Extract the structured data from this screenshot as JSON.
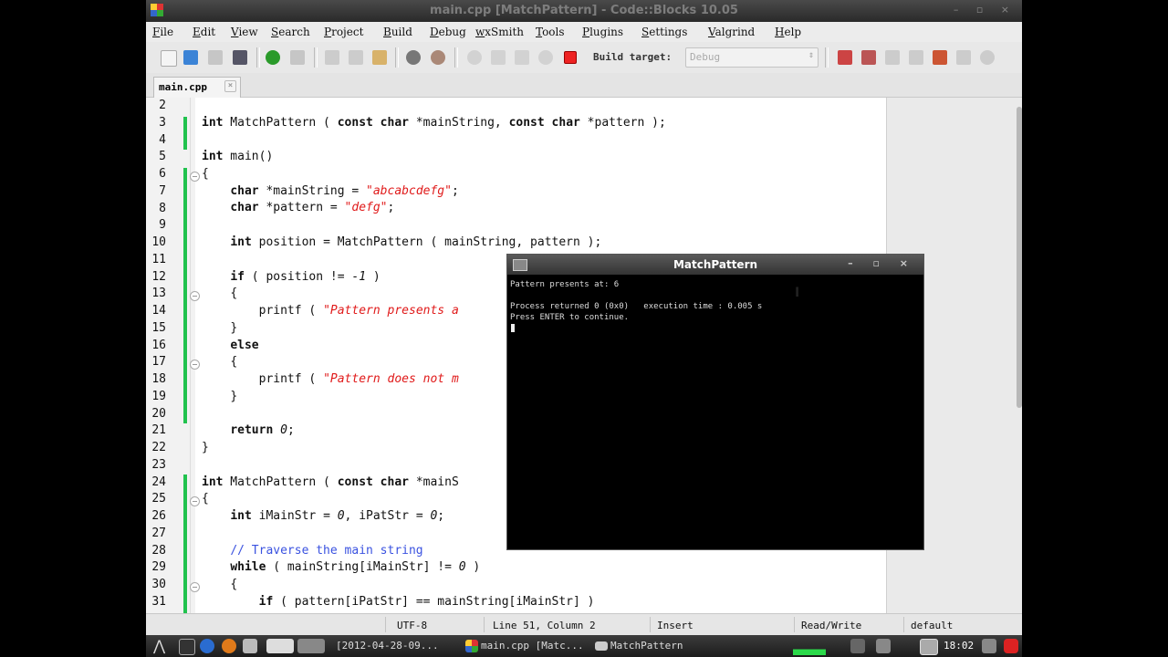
{
  "window": {
    "title": "main.cpp [MatchPattern] - Code::Blocks 10.05",
    "controls": "– ▫ ×"
  },
  "menu": [
    "File",
    "Edit",
    "View",
    "Search",
    "Project",
    "Build",
    "Debug",
    "wxSmith",
    "Tools",
    "Plugins",
    "Settings",
    "Valgrind",
    "Help"
  ],
  "toolbar": {
    "build_target_label": "Build target:",
    "build_target_value": "Debug"
  },
  "tabs": [
    {
      "label": "main.cpp",
      "close": "×"
    }
  ],
  "editor": {
    "lines": [
      {
        "n": "2"
      },
      {
        "n": "3"
      },
      {
        "n": "4"
      },
      {
        "n": "5"
      },
      {
        "n": "6"
      },
      {
        "n": "7"
      },
      {
        "n": "8"
      },
      {
        "n": "9"
      },
      {
        "n": "10"
      },
      {
        "n": "11"
      },
      {
        "n": "12"
      },
      {
        "n": "13"
      },
      {
        "n": "14"
      },
      {
        "n": "15"
      },
      {
        "n": "16"
      },
      {
        "n": "17"
      },
      {
        "n": "18"
      },
      {
        "n": "19"
      },
      {
        "n": "20"
      },
      {
        "n": "21"
      },
      {
        "n": "22"
      },
      {
        "n": "23"
      },
      {
        "n": "24"
      },
      {
        "n": "25"
      },
      {
        "n": "26"
      },
      {
        "n": "27"
      },
      {
        "n": "28"
      },
      {
        "n": "29"
      },
      {
        "n": "30"
      },
      {
        "n": "31"
      }
    ],
    "code": {
      "l3_kw1": "int",
      "l3_a": " MatchPattern ( ",
      "l3_kw2": "const char",
      "l3_b": " *mainString, ",
      "l3_kw3": "const char",
      "l3_c": " *pattern );",
      "l5_kw": "int",
      "l5_a": " main()",
      "l6": "{",
      "l7_kw": "char",
      "l7_a": " *mainString = ",
      "l7_str": "\"abcabcdefg\"",
      "l7_b": ";",
      "l8_kw": "char",
      "l8_a": " *pattern = ",
      "l8_str": "\"defg\"",
      "l8_b": ";",
      "l10_kw": "int",
      "l10_a": " position = MatchPattern ( mainString, pattern );",
      "l12_kw": "if",
      "l12_a": " ( position != ",
      "l12_num": "-1",
      "l12_b": " )",
      "l13": "{",
      "l14_a": "printf ( ",
      "l14_str": "\"Pattern presents a",
      "l15": "}",
      "l16_kw": "else",
      "l17": "{",
      "l18_a": "printf ( ",
      "l18_str": "\"Pattern does not m",
      "l19": "}",
      "l21_kw": "return",
      "l21_num": " 0",
      "l21_b": ";",
      "l22": "}",
      "l24_kw1": "int",
      "l24_a": " MatchPattern ( ",
      "l24_kw2": "const char",
      "l24_b": " *mainS",
      "l25": "{",
      "l26_kw": "int",
      "l26_a": " iMainStr = ",
      "l26_n1": "0",
      "l26_b": ", iPatStr = ",
      "l26_n2": "0",
      "l26_c": ";",
      "l28_cmt": "// Traverse the main string",
      "l29_kw": "while",
      "l29_a": " ( mainString[iMainStr] != ",
      "l29_num": "0",
      "l29_b": " )",
      "l30": "{",
      "l31_kw": "if",
      "l31_a": " ( pattern[iPatStr] == mainString[iMainStr] )"
    }
  },
  "console": {
    "title": "MatchPattern",
    "output": "Pattern presents at: 6\n\nProcess returned 0 (0x0)   execution time : 0.005 s\nPress ENTER to continue."
  },
  "status": {
    "encoding": "UTF-8",
    "position": "Line 51, Column 2",
    "mode": "Insert",
    "access": "Read/Write",
    "profile": "default"
  },
  "taskbar": {
    "items": [
      "[2012-04-28-09...",
      "main.cpp [Matc...",
      "MatchPattern"
    ],
    "clock": "18:02"
  },
  "colors": {
    "accent_green": "#21c24e",
    "string_red": "#e01a1a",
    "comment_blue": "#3a52e0"
  }
}
